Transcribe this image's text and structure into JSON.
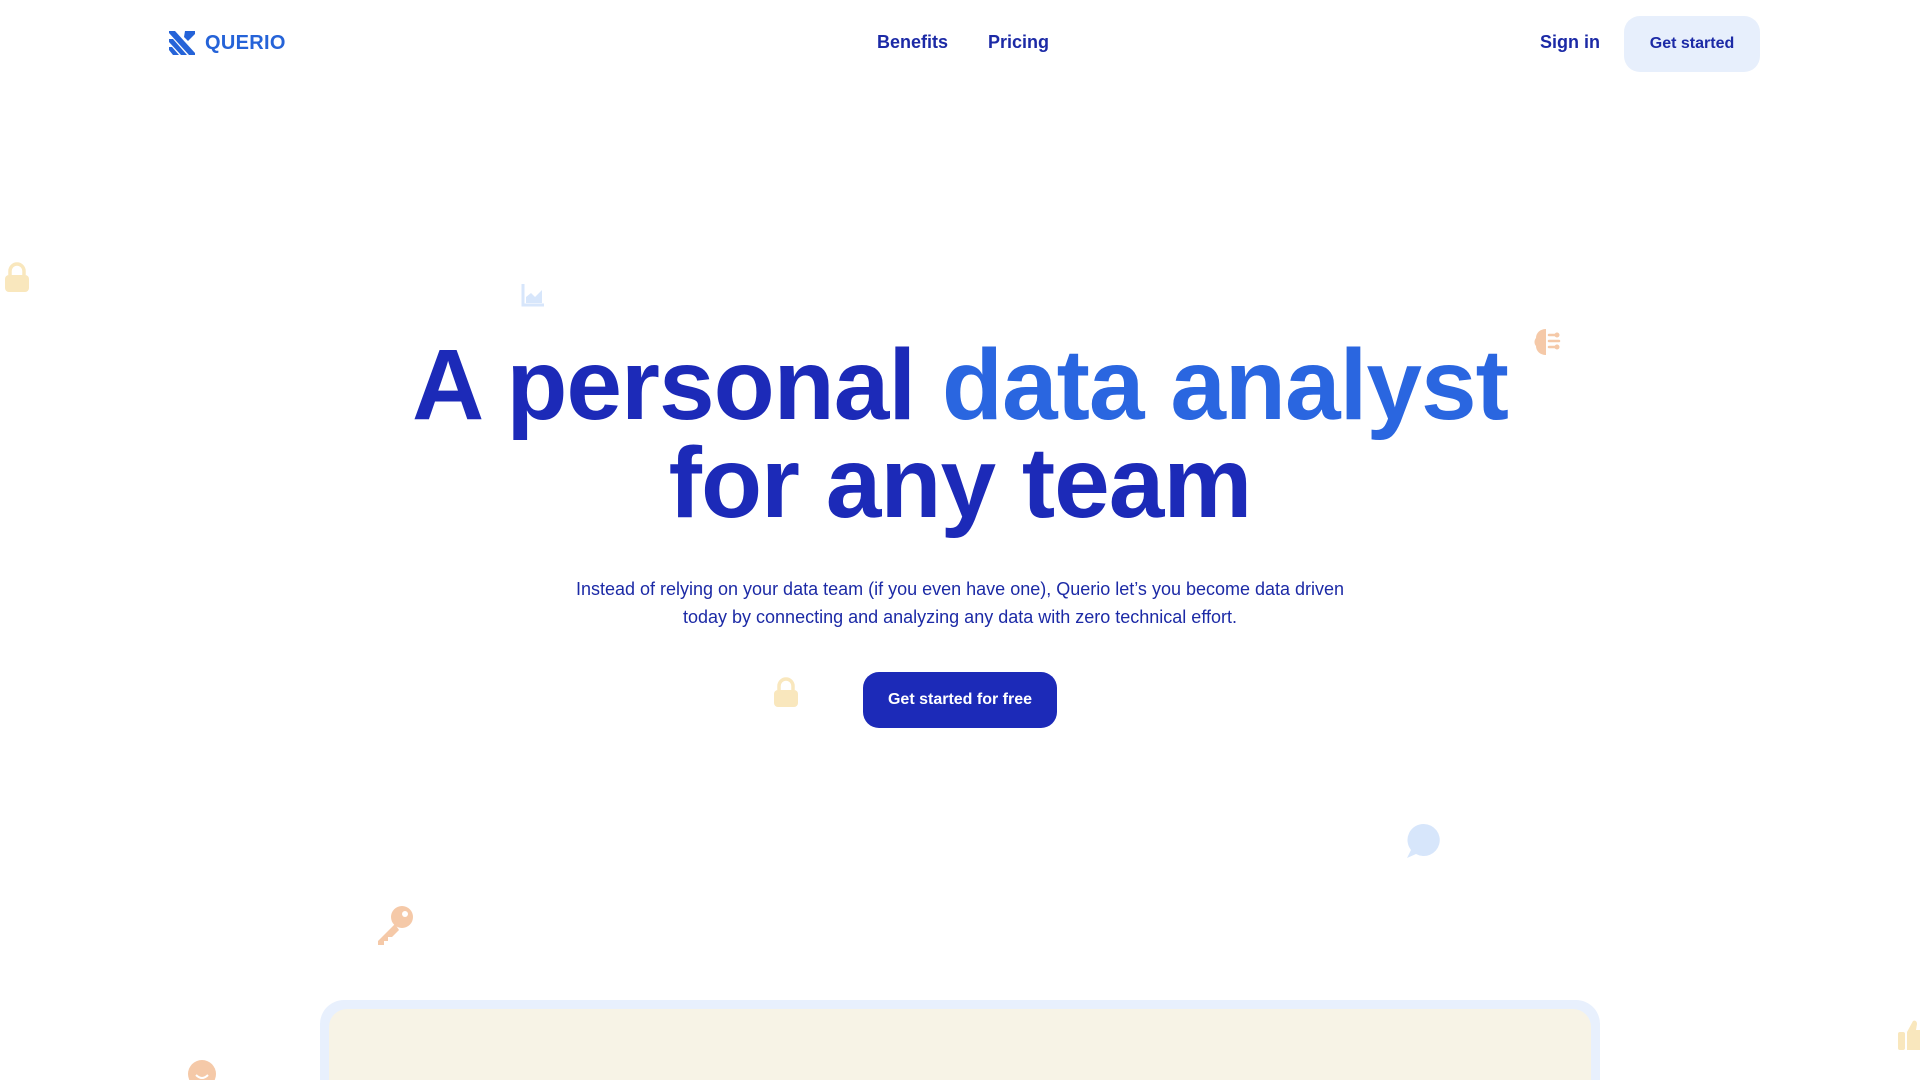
{
  "nav": {
    "brand": "QUERIO",
    "links": [
      "Benefits",
      "Pricing"
    ],
    "sign_in": "Sign in",
    "cta": "Get started"
  },
  "hero": {
    "title_part1": "A personal ",
    "title_accent": "data analyst",
    "title_part2": "for any team",
    "subtitle": "Instead of relying on your data team (if you even have one), Querio let’s you become data driven today by connecting and analyzing any data with zero technical effort.",
    "cta": "Get started for free"
  },
  "colors": {
    "brand_dark": "#1c2ab8",
    "brand_accent": "#2a66e0",
    "button_light": "#e7effc",
    "deco_yellow": "#f9e7bd",
    "deco_orange": "#f5c9a8",
    "deco_blue": "#d7e6fb"
  },
  "decorative_icons": [
    "lock-icon",
    "chart-icon",
    "brain-icon",
    "lock-icon",
    "chat-bubble-icon",
    "key-icon",
    "smiley-icon",
    "thumbs-up-icon"
  ]
}
